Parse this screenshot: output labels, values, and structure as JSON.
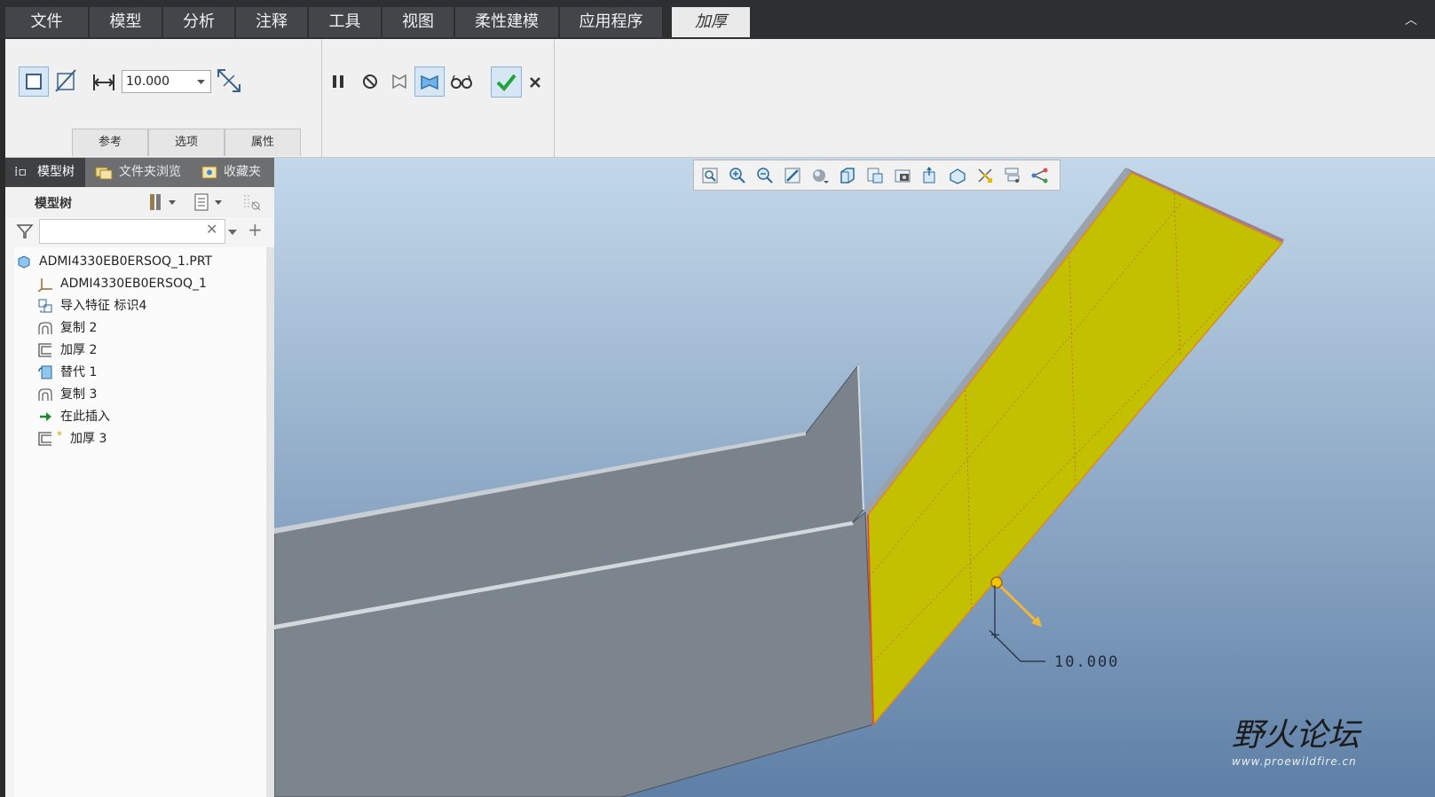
{
  "menu": {
    "tabs": [
      {
        "label": "文件"
      },
      {
        "label": "模型"
      },
      {
        "label": "分析"
      },
      {
        "label": "注释"
      },
      {
        "label": "工具"
      },
      {
        "label": "视图"
      },
      {
        "label": "柔性建模"
      },
      {
        "label": "应用程序"
      },
      {
        "label": "加厚"
      }
    ],
    "active": "加厚"
  },
  "ribbon": {
    "thickness_value": "10.000",
    "sub_tabs": [
      {
        "label": "参考"
      },
      {
        "label": "选项"
      },
      {
        "label": "属性"
      }
    ],
    "icons": [
      "solid-thicken-icon",
      "remove-material-icon",
      "thickness-dimension-icon",
      "flip-direction-icon",
      "pause-icon",
      "no-preview-icon",
      "geometry-preview-icon",
      "feature-preview-icon",
      "verify-icon",
      "confirm-icon",
      "cancel-icon"
    ]
  },
  "navigator": {
    "tabs": [
      {
        "label": "模型树"
      },
      {
        "label": "文件夹浏览"
      },
      {
        "label": "收藏夹"
      }
    ],
    "header_label": "模型树",
    "search_placeholder": "",
    "tree": [
      {
        "label": "ADMI4330EB0ERSOQ_1.PRT",
        "icon": "part-icon"
      },
      {
        "label": "ADMI4330EB0ERSOQ_1",
        "icon": "coordinate-system-icon"
      },
      {
        "label": "导入特征 标识4",
        "icon": "import-feature-icon"
      },
      {
        "label": "复制 2",
        "icon": "copy-surface-icon"
      },
      {
        "label": "加厚 2",
        "icon": "thicken-icon"
      },
      {
        "label": "替代 1",
        "icon": "replace-icon"
      },
      {
        "label": "复制 3",
        "icon": "copy-surface-icon"
      },
      {
        "label": "在此插入",
        "icon": "insert-here-arrow-icon"
      },
      {
        "label": "加厚 3",
        "icon": "thicken-icon",
        "marker": "*"
      }
    ]
  },
  "viewport": {
    "dimension_value": "10.000",
    "watermark_title": "野火论坛",
    "watermark_url": "www.proewildfire.cn",
    "colors": {
      "surface_yellow": "#c2c000",
      "part_gray": "#7a838c",
      "bg_top": "#c3d8ea",
      "bg_bottom": "#5e7fa6"
    }
  }
}
